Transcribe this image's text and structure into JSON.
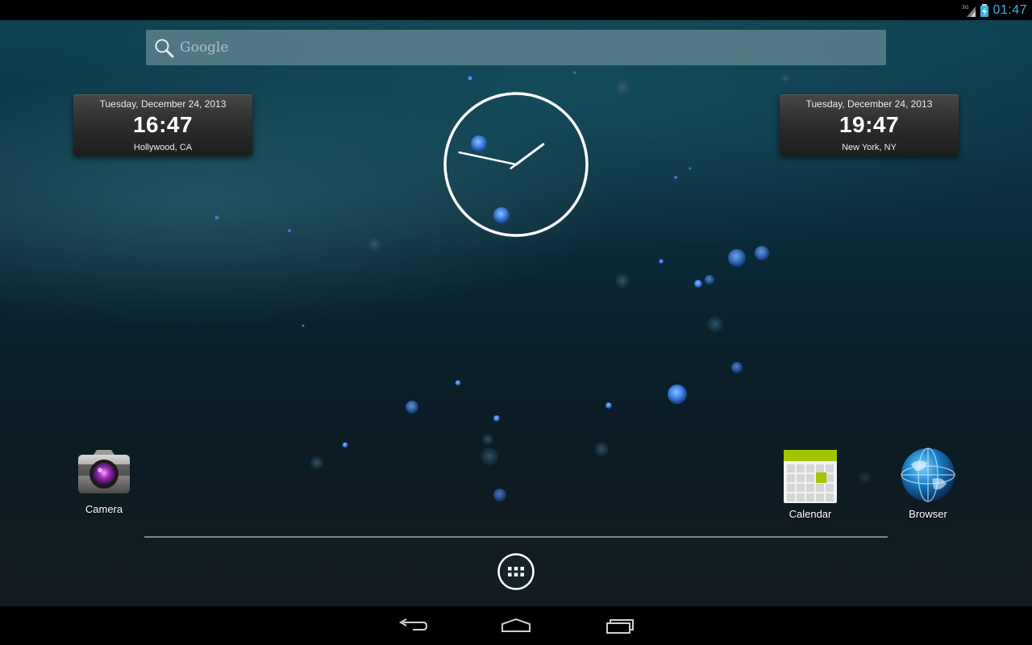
{
  "status_bar": {
    "network_label": "3G",
    "time": "01:47",
    "accent_color": "#33b5e5"
  },
  "search": {
    "placeholder": "Google",
    "icon": "search-icon"
  },
  "world_clocks": [
    {
      "date": "Tuesday, December 24, 2013",
      "time": "16:47",
      "city": "Hollywood, CA"
    },
    {
      "date": "Tuesday, December 24, 2013",
      "time": "19:47",
      "city": "New York, NY"
    }
  ],
  "analog_clock": {
    "hours": 1,
    "minutes": 47
  },
  "apps": [
    {
      "label": "Camera",
      "icon": "camera-icon"
    },
    {
      "label": "Calendar",
      "icon": "calendar-icon"
    },
    {
      "label": "Browser",
      "icon": "browser-globe-icon"
    }
  ],
  "dock": {
    "all_apps_icon": "all-apps-icon"
  },
  "nav_bar": {
    "buttons": [
      {
        "name": "back",
        "icon": "back-icon"
      },
      {
        "name": "home",
        "icon": "home-icon"
      },
      {
        "name": "recents",
        "icon": "recents-icon"
      }
    ]
  }
}
